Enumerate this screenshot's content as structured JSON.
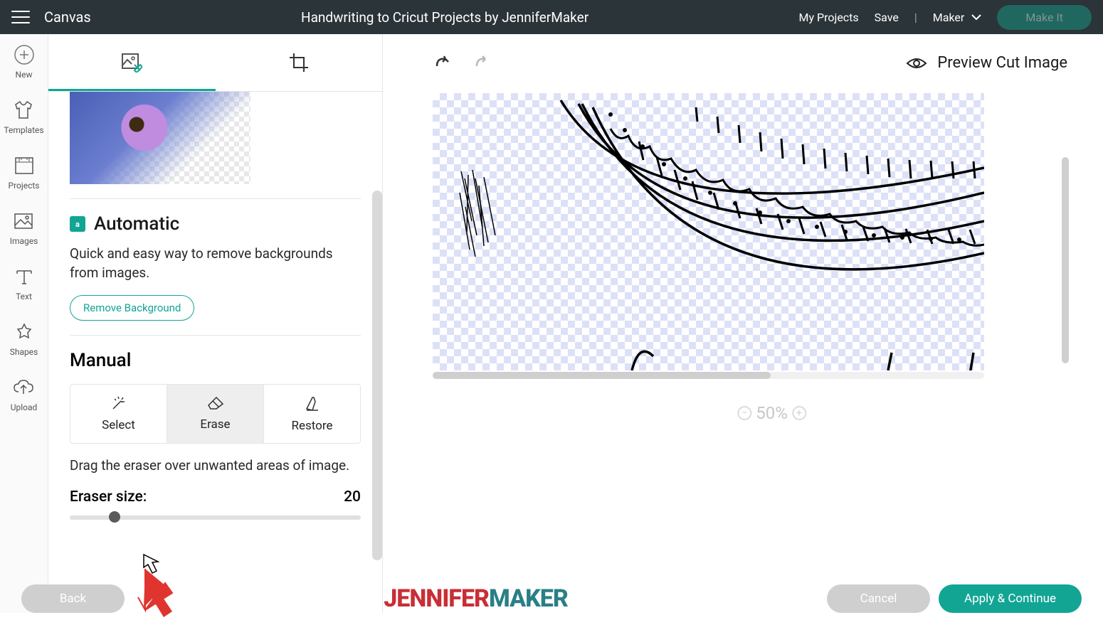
{
  "top": {
    "canvas_label": "Canvas",
    "title": "Handwriting to Cricut Projects by JenniferMaker",
    "my_projects": "My Projects",
    "save": "Save",
    "machine": "Maker",
    "make_it": "Make It"
  },
  "rail": {
    "new": "New",
    "templates": "Templates",
    "projects": "Projects",
    "images": "Images",
    "text": "Text",
    "shapes": "Shapes",
    "upload": "Upload"
  },
  "panel": {
    "automatic_title": "Automatic",
    "automatic_desc": "Quick and easy way to remove backgrounds from images.",
    "remove_bg_btn": "Remove Background",
    "manual_title": "Manual",
    "seg_select": "Select",
    "seg_erase": "Erase",
    "seg_restore": "Restore",
    "manual_desc": "Drag the eraser over unwanted areas of image.",
    "eraser_label": "Eraser size:",
    "eraser_value": "20"
  },
  "canvas": {
    "preview_label": "Preview Cut Image",
    "zoom": "50%"
  },
  "footer": {
    "back": "Back",
    "cancel": "Cancel",
    "apply": "Apply & Continue",
    "brand_first": "JENNIFER",
    "brand_last": "MAKER"
  }
}
